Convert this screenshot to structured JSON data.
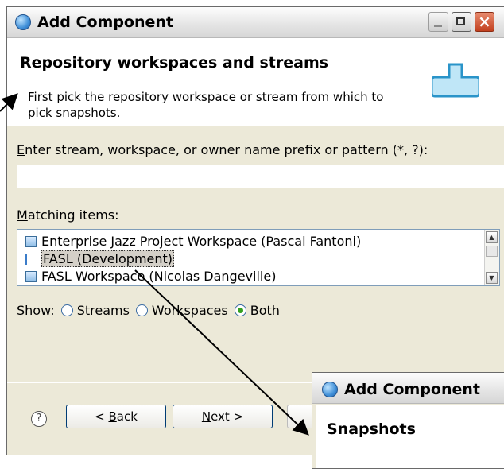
{
  "window": {
    "title": "Add Component"
  },
  "header": {
    "title": "Repository workspaces and streams",
    "description": "First pick the repository workspace or stream from which to pick snapshots."
  },
  "filter": {
    "label_mnemonic": "E",
    "label_rest": "nter stream, workspace, or owner name prefix or pattern (*, ?):",
    "value": ""
  },
  "matching": {
    "label_mnemonic": "M",
    "label_rest": "atching items:",
    "items": [
      {
        "label": "Enterprise Jazz Project Workspace (Pascal Fantoni)",
        "icon": "workspace-icon"
      },
      {
        "label": "FASL (Development)",
        "icon": "stream-icon",
        "selected": true
      },
      {
        "label": "FASL Workspace (Nicolas Dangeville)",
        "icon": "workspace-icon"
      }
    ]
  },
  "show": {
    "label": "Show:",
    "options": [
      {
        "mnemonic": "S",
        "rest": "treams"
      },
      {
        "mnemonic": "W",
        "rest": "orkspaces"
      },
      {
        "mnemonic": "B",
        "rest": "oth",
        "selected": true
      }
    ]
  },
  "buttons": {
    "help": "?",
    "back_prefix": "< ",
    "back_mnemonic": "B",
    "back_rest": "ack",
    "next_mnemonic": "N",
    "next_rest": "ext >"
  },
  "next_dialog": {
    "title": "Add Component",
    "heading": "Snapshots"
  },
  "colors": {
    "selected_radio": "#33a020",
    "accent": "#3b7cc9",
    "arrow": "#000000"
  }
}
